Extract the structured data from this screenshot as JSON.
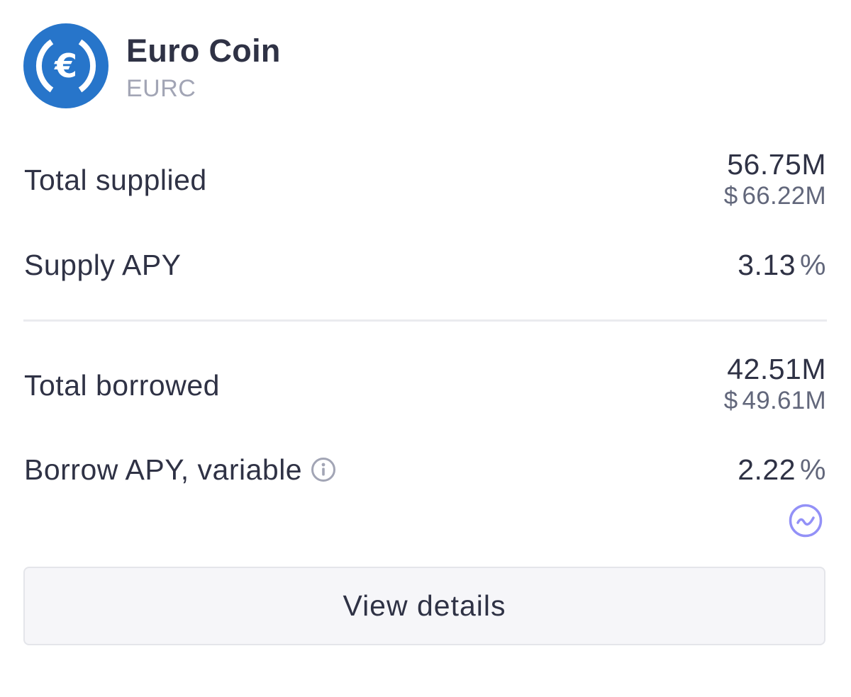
{
  "asset": {
    "name": "Euro Coin",
    "symbol": "EURC",
    "logo_icon": "euro-coin-icon",
    "logo_color": "#2775ca"
  },
  "supply": {
    "total_label": "Total supplied",
    "total_value": "56.75M",
    "total_usd_symbol": "$",
    "total_usd_value": "66.22M",
    "apy_label": "Supply APY",
    "apy_value": "3.13",
    "apy_unit": "%"
  },
  "borrow": {
    "total_label": "Total borrowed",
    "total_value": "42.51M",
    "total_usd_symbol": "$",
    "total_usd_value": "49.61M",
    "apy_label": "Borrow APY, variable",
    "apy_value": "2.22",
    "apy_unit": "%",
    "info_icon": "info-icon",
    "rate_icon": "variable-rate-icon",
    "rate_icon_color": "#9391f7"
  },
  "actions": {
    "view_details_label": "View details"
  },
  "colors": {
    "text_primary": "#2f3245",
    "text_secondary": "#62677b",
    "text_muted": "#a2a5b5",
    "divider": "#eaebef",
    "button_bg": "#f6f6f9",
    "button_border": "#e4e5ea"
  }
}
